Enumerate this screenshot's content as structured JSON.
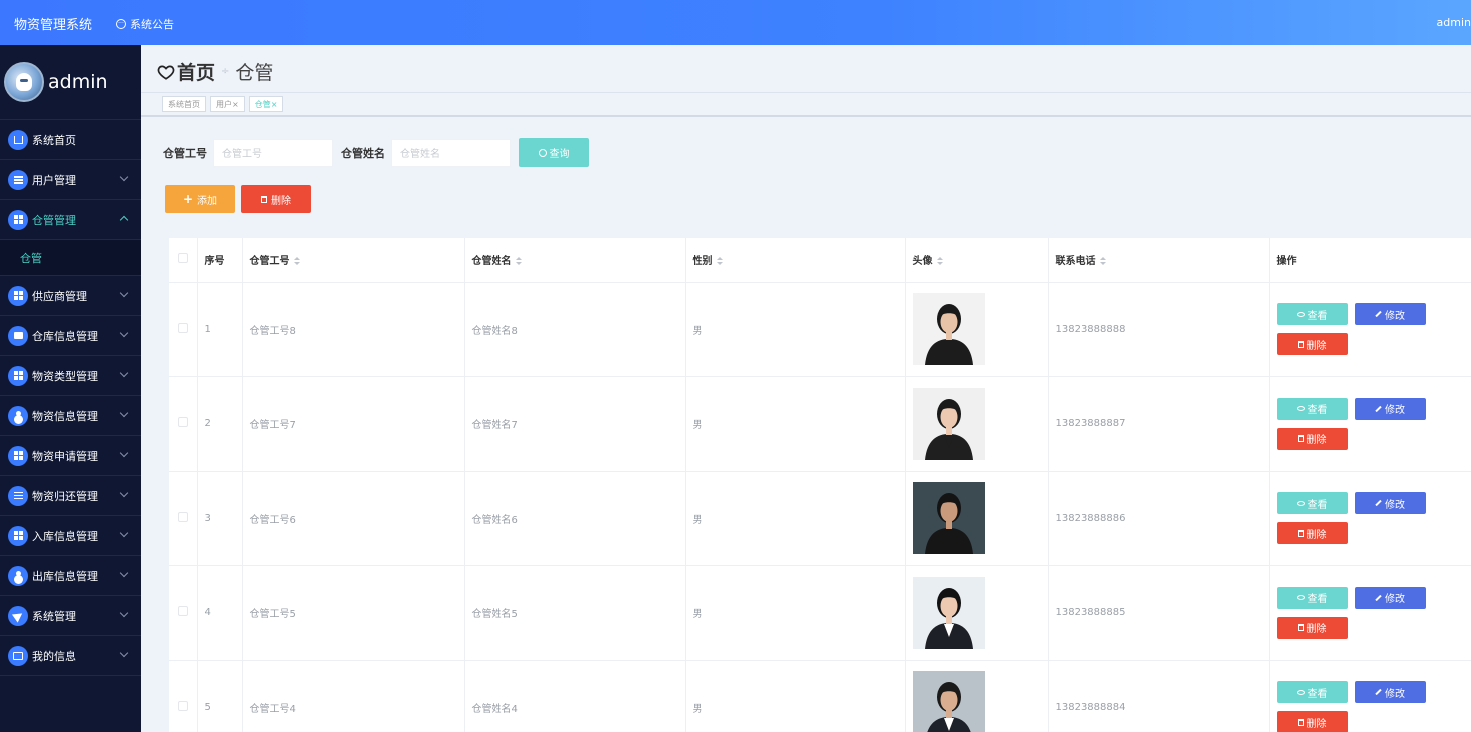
{
  "topbar": {
    "brand": "物资管理系统",
    "notice": "系统公告",
    "user": "admin"
  },
  "sidebar": {
    "username": "admin",
    "items": [
      {
        "label": "系统首页",
        "icon": "home-icon",
        "expandable": false
      },
      {
        "label": "用户管理",
        "icon": "list-icon",
        "expandable": true
      },
      {
        "label": "仓管管理",
        "icon": "grid-icon",
        "expandable": true,
        "expanded": true,
        "children": [
          "仓管"
        ]
      },
      {
        "label": "供应商管理",
        "icon": "grid-icon",
        "expandable": true
      },
      {
        "label": "仓库信息管理",
        "icon": "box-icon",
        "expandable": true
      },
      {
        "label": "物资类型管理",
        "icon": "grid-icon",
        "expandable": true
      },
      {
        "label": "物资信息管理",
        "icon": "user-icon",
        "expandable": true
      },
      {
        "label": "物资申请管理",
        "icon": "grid-icon",
        "expandable": true
      },
      {
        "label": "物资归还管理",
        "icon": "slider-icon",
        "expandable": true
      },
      {
        "label": "入库信息管理",
        "icon": "grid-icon",
        "expandable": true
      },
      {
        "label": "出库信息管理",
        "icon": "user-icon",
        "expandable": true
      },
      {
        "label": "系统管理",
        "icon": "send-icon",
        "expandable": true
      },
      {
        "label": "我的信息",
        "icon": "card-icon",
        "expandable": true
      }
    ]
  },
  "breadcrumb": {
    "home": "首页",
    "separator": "÷",
    "current": "仓管"
  },
  "tabs": [
    "系统首页",
    "用户×",
    "仓管×"
  ],
  "search": {
    "field1_label": "仓管工号",
    "field1_placeholder": "仓管工号",
    "field2_label": "仓管姓名",
    "field2_placeholder": "仓管姓名",
    "query_label": "查询"
  },
  "actions": {
    "add": "添加",
    "delete": "删除"
  },
  "table": {
    "headers": [
      "序号",
      "仓管工号",
      "仓管姓名",
      "性别",
      "头像",
      "联系电话",
      "操作"
    ],
    "rows": [
      {
        "no": "1",
        "id": "仓管工号8",
        "name": "仓管姓名8",
        "gender": "男",
        "phone": "13823888888"
      },
      {
        "no": "2",
        "id": "仓管工号7",
        "name": "仓管姓名7",
        "gender": "男",
        "phone": "13823888887"
      },
      {
        "no": "3",
        "id": "仓管工号6",
        "name": "仓管姓名6",
        "gender": "男",
        "phone": "13823888886"
      },
      {
        "no": "4",
        "id": "仓管工号5",
        "name": "仓管姓名5",
        "gender": "男",
        "phone": "13823888885"
      },
      {
        "no": "5",
        "id": "仓管工号4",
        "name": "仓管姓名4",
        "gender": "男",
        "phone": "13823888884"
      }
    ],
    "op_view": "查看",
    "op_edit": "修改",
    "op_delete": "删除"
  },
  "colors": {
    "topbar": "#3b78ff",
    "sidebar": "#0f1733",
    "accent": "#4fd1c5",
    "add": "#f5a53c",
    "danger": "#ee4b36",
    "edit": "#4f6ee3"
  }
}
